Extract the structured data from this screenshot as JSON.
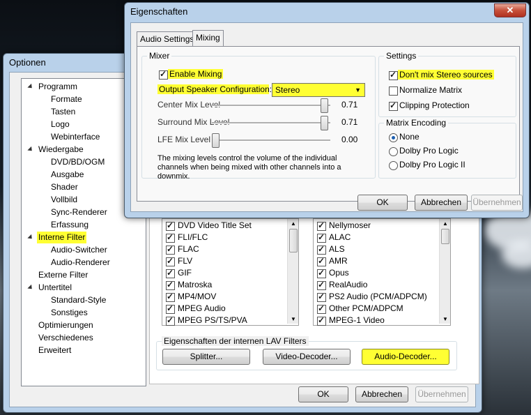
{
  "options_dialog": {
    "title": "Optionen",
    "tree": [
      {
        "label": "Programm",
        "level": 0,
        "expanded": true
      },
      {
        "label": "Formate",
        "level": 1
      },
      {
        "label": "Tasten",
        "level": 1
      },
      {
        "label": "Logo",
        "level": 1
      },
      {
        "label": "Webinterface",
        "level": 1
      },
      {
        "label": "Wiedergabe",
        "level": 0,
        "expanded": true
      },
      {
        "label": "DVD/BD/OGM",
        "level": 1
      },
      {
        "label": "Ausgabe",
        "level": 1
      },
      {
        "label": "Shader",
        "level": 1
      },
      {
        "label": "Vollbild",
        "level": 1
      },
      {
        "label": "Sync-Renderer",
        "level": 1
      },
      {
        "label": "Erfassung",
        "level": 1
      },
      {
        "label": "Interne Filter",
        "level": 0,
        "expanded": true,
        "highlighted": true
      },
      {
        "label": "Audio-Switcher",
        "level": 1
      },
      {
        "label": "Audio-Renderer",
        "level": 1
      },
      {
        "label": "Externe Filter",
        "level": 0
      },
      {
        "label": "Untertitel",
        "level": 0,
        "expanded": true
      },
      {
        "label": "Standard-Style",
        "level": 1
      },
      {
        "label": "Sonstiges",
        "level": 1
      },
      {
        "label": "Optimierungen",
        "level": 0
      },
      {
        "label": "Verschiedenes",
        "level": 0
      },
      {
        "label": "Erweitert",
        "level": 0
      }
    ],
    "left_list": [
      "DVD Video Title Set",
      "FLI/FLC",
      "FLAC",
      "FLV",
      "GIF",
      "Matroska",
      "MP4/MOV",
      "MPEG Audio",
      "MPEG PS/TS/PVA"
    ],
    "right_list": [
      "Nellymoser",
      "ALAC",
      "ALS",
      "AMR",
      "Opus",
      "RealAudio",
      "PS2 Audio (PCM/ADPCM)",
      "Other PCM/ADPCM",
      "MPEG-1 Video"
    ],
    "lav_group_label": "Eigenschaften der internen LAV Filters",
    "splitter_button": "Splitter...",
    "video_decoder_button": "Video-Decoder...",
    "audio_decoder_button": "Audio-Decoder...",
    "ok": "OK",
    "cancel": "Abbrechen",
    "apply": "Übernehmen"
  },
  "properties_dialog": {
    "title": "Eigenschaften",
    "close_glyph": "✕",
    "tabs": [
      {
        "label": "Audio Settings",
        "active": false
      },
      {
        "label": "Mixing",
        "active": true
      }
    ],
    "mixer": {
      "group_label": "Mixer",
      "enable_mixing": {
        "label": "Enable Mixing",
        "checked": true
      },
      "speaker_config_label": "Output Speaker Configuration:",
      "speaker_config_value": "Stereo",
      "sliders": [
        {
          "label": "Center Mix Level",
          "value_text": "0.71",
          "value": 0.71
        },
        {
          "label": "Surround Mix Level",
          "value_text": "0.71",
          "value": 0.71
        },
        {
          "label": "LFE Mix Level",
          "value_text": "0.00",
          "value": 0.0
        }
      ],
      "description": "The mixing levels control the volume of the individual channels when being mixed with other channels into a downmix."
    },
    "settings": {
      "group_label": "Settings",
      "dont_mix_stereo": {
        "label": "Don't mix Stereo sources",
        "checked": true
      },
      "normalize_matrix": {
        "label": "Normalize Matrix",
        "checked": false
      },
      "clipping_protection": {
        "label": "Clipping Protection",
        "checked": true
      }
    },
    "matrix_encoding": {
      "group_label": "Matrix Encoding",
      "options": [
        {
          "label": "None",
          "selected": true
        },
        {
          "label": "Dolby Pro Logic",
          "selected": false
        },
        {
          "label": "Dolby Pro Logic II",
          "selected": false
        }
      ]
    },
    "ok": "OK",
    "cancel": "Abbrechen",
    "apply": "Übernehmen"
  },
  "colors": {
    "highlight": "#ffff33",
    "window_frame": "#b9d1ea",
    "dialog_face": "#f0f0f0"
  }
}
